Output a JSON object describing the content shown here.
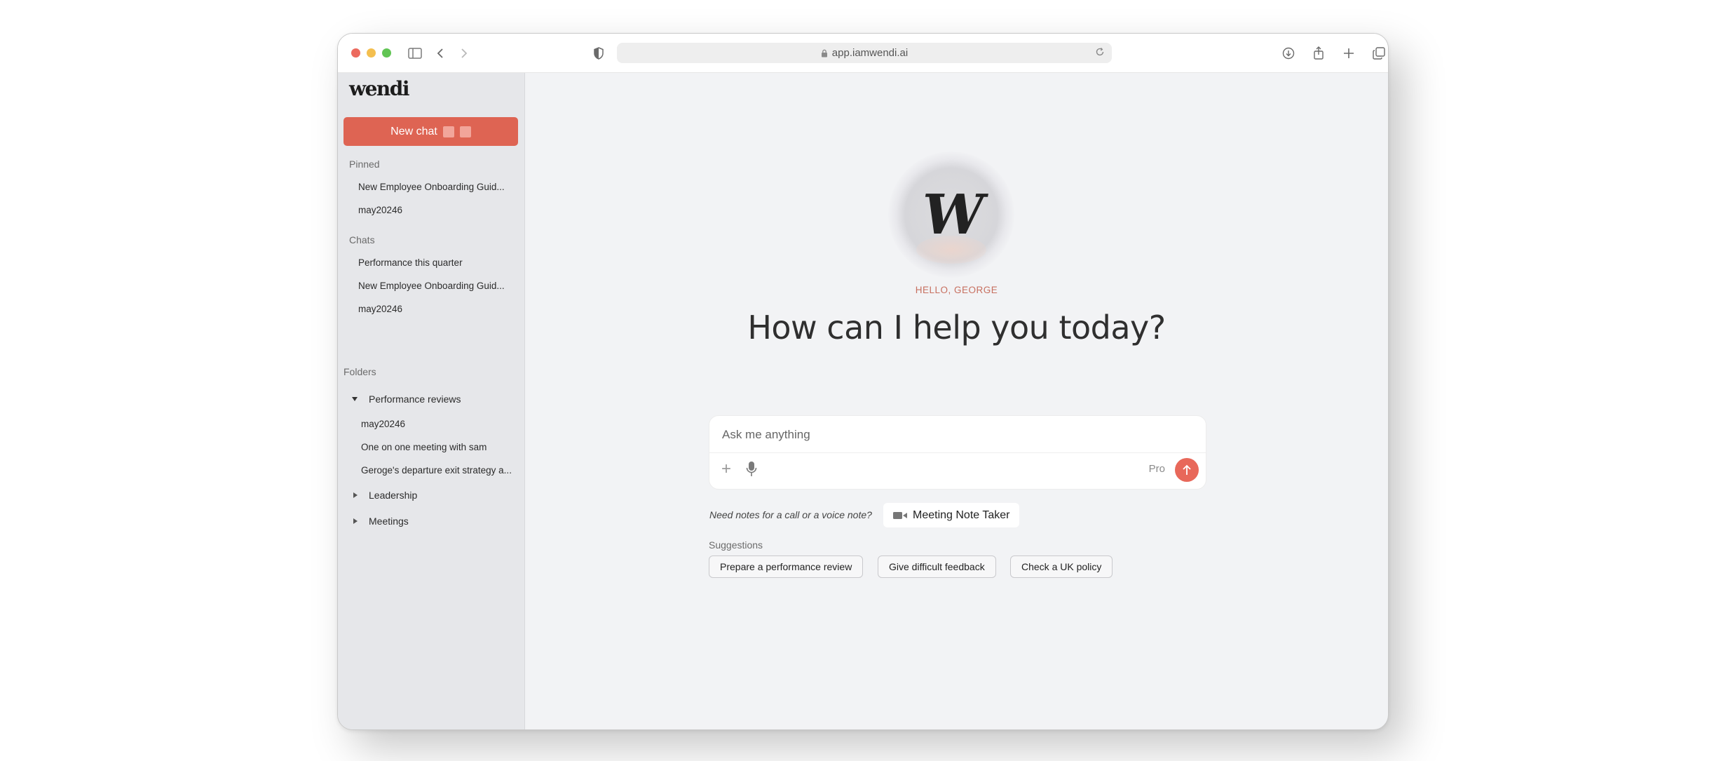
{
  "browser": {
    "url": "app.iamwendi.ai"
  },
  "sidebar": {
    "logo": "wendi",
    "new_chat_label": "New chat",
    "pinned_label": "Pinned",
    "pinned": [
      "New Employee Onboarding Guid...",
      "may20246"
    ],
    "chats_label": "Chats",
    "chats": [
      "Performance this quarter",
      "New Employee Onboarding Guid...",
      "may20246"
    ],
    "folders_label": "Folders",
    "folders": [
      {
        "name": "Performance reviews",
        "expanded": true,
        "items": [
          "may20246",
          "One on one meeting with sam",
          "Geroge's departure exit strategy a..."
        ]
      },
      {
        "name": "Leadership",
        "expanded": false
      },
      {
        "name": "Meetings",
        "expanded": false
      }
    ]
  },
  "main": {
    "avatar_letter": "W",
    "greeting": "HELLO, GEORGE",
    "headline": "How can I help you today?",
    "composer": {
      "placeholder": "Ask me anything",
      "pro_label": "Pro"
    },
    "notes_prompt": "Need notes for a call or a voice note?",
    "note_taker_label": "Meeting Note Taker",
    "suggestions_label": "Suggestions",
    "suggestions": [
      "Prepare a performance review",
      "Give difficult feedback",
      "Check a UK policy"
    ]
  },
  "colors": {
    "accent": "#de6453",
    "send_button": "#e8685a",
    "greeting": "#c76f5f"
  }
}
